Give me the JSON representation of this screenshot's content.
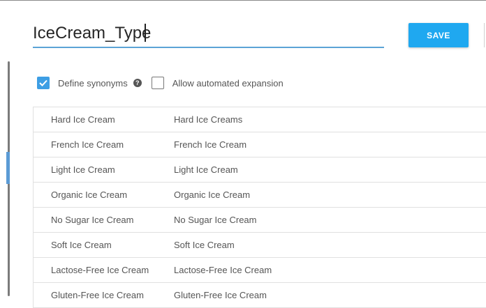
{
  "entity": {
    "name": "IceCream_Type"
  },
  "toolbar": {
    "save_label": "SAVE"
  },
  "options": {
    "define_synonyms": {
      "label": "Define synonyms",
      "checked": true
    },
    "allow_expansion": {
      "label": "Allow automated expansion",
      "checked": false
    }
  },
  "rows": [
    {
      "value": "Hard Ice Cream",
      "synonym": "Hard Ice Creams"
    },
    {
      "value": "French Ice Cream",
      "synonym": "French Ice Cream"
    },
    {
      "value": "Light Ice Cream",
      "synonym": "Light Ice Cream"
    },
    {
      "value": "Organic Ice Cream",
      "synonym": "Organic Ice Cream"
    },
    {
      "value": "No Sugar Ice Cream",
      "synonym": "No Sugar Ice Cream"
    },
    {
      "value": "Soft Ice Cream",
      "synonym": "Soft Ice Cream"
    },
    {
      "value": "Lactose-Free Ice Cream",
      "synonym": "Lactose-Free Ice Cream"
    },
    {
      "value": "Gluten-Free Ice Cream",
      "synonym": "Gluten-Free Ice Cream"
    }
  ],
  "colors": {
    "accent": "#1fa8f0",
    "checkbox": "#3d9ee4",
    "underline": "#5ba3d6"
  },
  "icons": {
    "help": "help-circle-icon",
    "check": "check-icon"
  }
}
